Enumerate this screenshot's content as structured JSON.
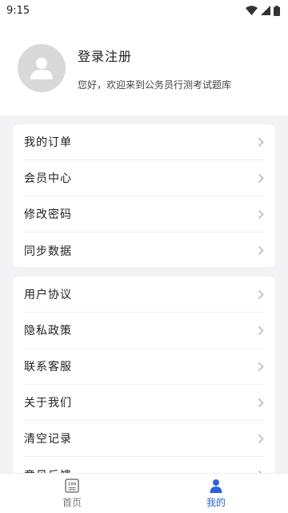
{
  "status_bar": {
    "time": "9:15"
  },
  "profile": {
    "login_label": "登录注册",
    "welcome_text": "您好，欢迎来到公务员行测考试题库"
  },
  "menu_group_1": [
    {
      "label": "我的订单"
    },
    {
      "label": "会员中心"
    },
    {
      "label": "修改密码"
    },
    {
      "label": "同步数据"
    }
  ],
  "menu_group_2": [
    {
      "label": "用户协议"
    },
    {
      "label": "隐私政策"
    },
    {
      "label": "联系客服"
    },
    {
      "label": "关于我们"
    },
    {
      "label": "清空记录"
    },
    {
      "label": "意见反馈"
    }
  ],
  "bottom_nav": {
    "home_label": "首页",
    "home_icon_text": "100",
    "mine_label": "我的",
    "active_tab": "mine"
  },
  "colors": {
    "accent": "#2c63d6",
    "background": "#f3f3f5",
    "avatar": "#d9d9d9"
  }
}
